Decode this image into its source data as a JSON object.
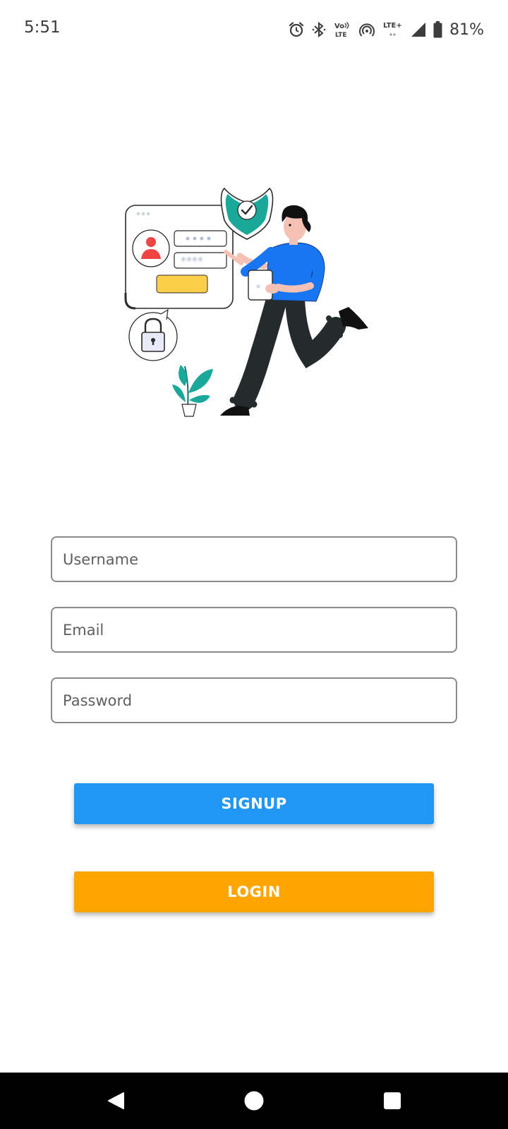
{
  "status_bar": {
    "time": "5:51",
    "battery_percent": "81%",
    "icons": [
      "alarm-icon",
      "bluetooth-icon",
      "volte-icon",
      "hotspot-icon",
      "lte-plus-icon",
      "cell-signal-icon",
      "battery-icon"
    ],
    "volte_label_top": "Vo",
    "volte_label_bottom": "LTE",
    "lte_label": "LTE+"
  },
  "illustration": {
    "description_icon": "login-security-illustration"
  },
  "form": {
    "username_placeholder": "Username",
    "email_placeholder": "Email",
    "password_placeholder": "Password"
  },
  "buttons": {
    "signup_label": "SIGNUP",
    "login_label": "LOGIN"
  },
  "colors": {
    "signup": "#2196f3",
    "login": "#ffa500",
    "field_border": "#8a8a8a",
    "shield": "#1aa89a",
    "shirt": "#1976f2"
  },
  "nav_bar": {
    "icons": [
      "back-icon",
      "home-icon",
      "recents-icon"
    ]
  }
}
